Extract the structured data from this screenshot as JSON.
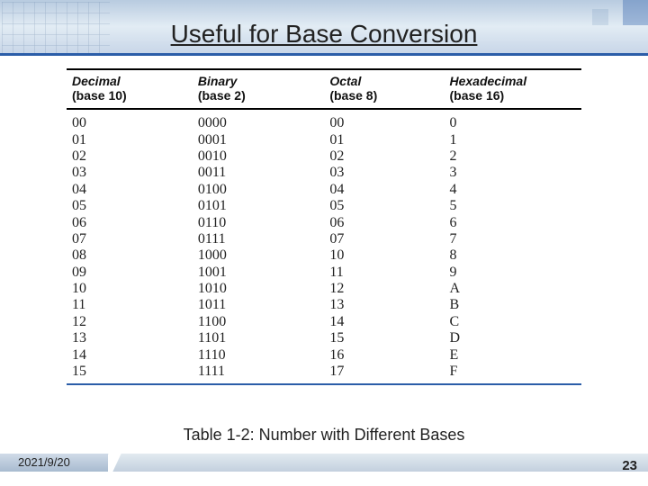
{
  "title": "Useful for Base Conversion",
  "caption": "Table 1-2: Number with Different Bases",
  "date": "2021/9/20",
  "page": "23",
  "headers": {
    "decimal": {
      "name": "Decimal",
      "base": "(base 10)"
    },
    "binary": {
      "name": "Binary",
      "base": "(base 2)"
    },
    "octal": {
      "name": "Octal",
      "base": "(base 8)"
    },
    "hex": {
      "name": "Hexadecimal",
      "base": "(base 16)"
    }
  },
  "chart_data": {
    "type": "table",
    "title": "Table 1-2: Number with Different Bases",
    "columns": [
      "Decimal (base 10)",
      "Binary (base 2)",
      "Octal (base 8)",
      "Hexadecimal (base 16)"
    ],
    "rows": [
      {
        "decimal": "00",
        "binary": "0000",
        "octal": "00",
        "hex": "0"
      },
      {
        "decimal": "01",
        "binary": "0001",
        "octal": "01",
        "hex": "1"
      },
      {
        "decimal": "02",
        "binary": "0010",
        "octal": "02",
        "hex": "2"
      },
      {
        "decimal": "03",
        "binary": "0011",
        "octal": "03",
        "hex": "3"
      },
      {
        "decimal": "04",
        "binary": "0100",
        "octal": "04",
        "hex": "4"
      },
      {
        "decimal": "05",
        "binary": "0101",
        "octal": "05",
        "hex": "5"
      },
      {
        "decimal": "06",
        "binary": "0110",
        "octal": "06",
        "hex": "6"
      },
      {
        "decimal": "07",
        "binary": "0111",
        "octal": "07",
        "hex": "7"
      },
      {
        "decimal": "08",
        "binary": "1000",
        "octal": "10",
        "hex": "8"
      },
      {
        "decimal": "09",
        "binary": "1001",
        "octal": "11",
        "hex": "9"
      },
      {
        "decimal": "10",
        "binary": "1010",
        "octal": "12",
        "hex": "A"
      },
      {
        "decimal": "11",
        "binary": "1011",
        "octal": "13",
        "hex": "B"
      },
      {
        "decimal": "12",
        "binary": "1100",
        "octal": "14",
        "hex": "C"
      },
      {
        "decimal": "13",
        "binary": "1101",
        "octal": "15",
        "hex": "D"
      },
      {
        "decimal": "14",
        "binary": "1110",
        "octal": "16",
        "hex": "E"
      },
      {
        "decimal": "15",
        "binary": "1111",
        "octal": "17",
        "hex": "F"
      }
    ]
  }
}
